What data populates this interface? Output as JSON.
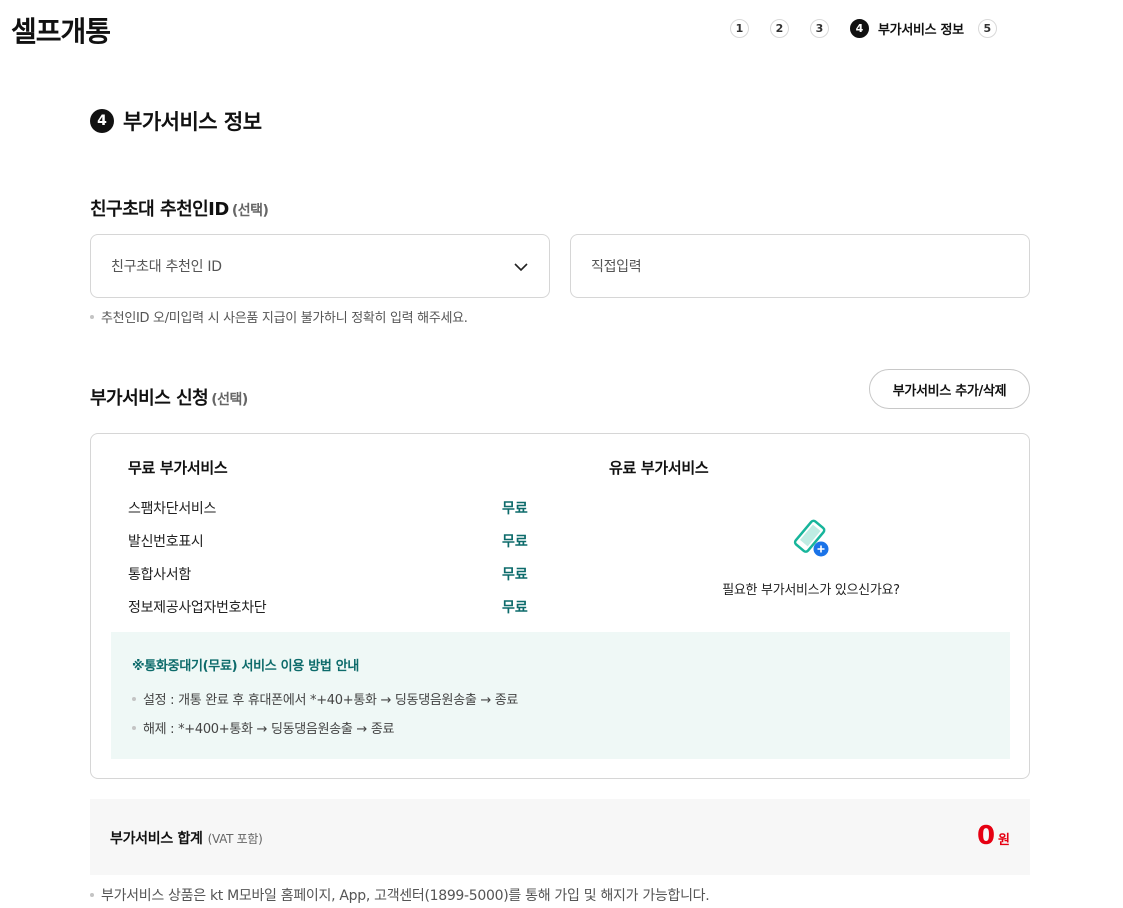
{
  "header": {
    "title": "셀프개통",
    "steps": [
      "1",
      "2",
      "3",
      "4",
      "5"
    ],
    "active_step_label": "부가서비스 정보"
  },
  "section": {
    "number": "4",
    "title": "부가서비스 정보"
  },
  "referral": {
    "title": "친구초대 추천인ID",
    "optional": "(선택)",
    "select_value": "친구초대 추천인 ID",
    "input_placeholder": "직접입력",
    "hint": "추천인ID 오/미입력 시 사은품 지급이 불가하니 정확히 입력 해주세요."
  },
  "addon": {
    "title": "부가서비스 신청",
    "optional": "(선택)",
    "edit_button": "부가서비스 추가/삭제",
    "free_title": "무료 부가서비스",
    "paid_title": "유료 부가서비스",
    "free_services": [
      {
        "name": "스팸차단서비스",
        "price": "무료"
      },
      {
        "name": "발신번호표시",
        "price": "무료"
      },
      {
        "name": "통합사서함",
        "price": "무료"
      },
      {
        "name": "정보제공사업자번호차단",
        "price": "무료"
      }
    ],
    "paid_empty_text": "필요한 부가서비스가 있으신가요?",
    "guide": {
      "title": "※통화중대기(무료) 서비스 이용 방법 안내",
      "lines": [
        "설정 : 개통 완료 후 휴대폰에서 *+40+통화 → 딩동댕음원송출 → 종료",
        "해제 : *+400+통화 → 딩동댕음원송출 → 종료"
      ]
    }
  },
  "total": {
    "label": "부가서비스 합계",
    "vat": "(VAT 포함)",
    "value": "0",
    "unit": "원"
  },
  "footer_note": "부가서비스 상품은 kt M모바일 홈페이지, App, 고객센터(1899-5000)를 통해 가입 및 해지가 가능합니다.",
  "colors": {
    "accent_teal": "#0d6b6b",
    "price_red": "#e60012",
    "guide_bg": "#eff8f6",
    "icon_teal": "#17b59b",
    "icon_blue": "#1a73e8"
  },
  "icons": {
    "select_chevron": "chevron-down-icon",
    "paid_empty": "phone-add-icon"
  }
}
